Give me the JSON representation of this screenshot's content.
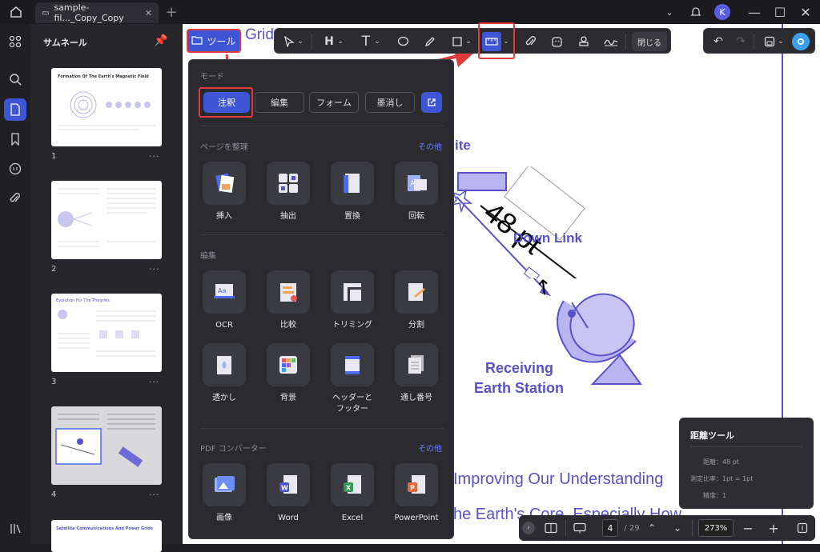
{
  "window": {
    "tab_title": "sample-fil..._Copy_Copy",
    "avatar_initial": "K"
  },
  "sidebar": {
    "title": "サムネール",
    "pages": [
      {
        "num": "1",
        "title": "Formation Of The Earth's Magnetic Field"
      },
      {
        "num": "2"
      },
      {
        "num": "3",
        "title": "Evolution For The Theories"
      },
      {
        "num": "4"
      },
      {
        "title": "Satellite Communications And Power Grids"
      }
    ]
  },
  "document": {
    "top_text": "Grid",
    "label_ite": "ite",
    "measure_label": "48 pt",
    "down_link": "Down Link",
    "receiving_line1": "Receiving",
    "receiving_line2": "Earth Station",
    "body_line1": "Improving Our Understanding",
    "body_line2": "he Earth's Core, Especially How"
  },
  "toolbar": {
    "tool_button": "ツール",
    "close_button": "閉じる"
  },
  "panel": {
    "mode_title": "モード",
    "modes": [
      "注釈",
      "編集",
      "フォーム",
      "墨消し"
    ],
    "organize_title": "ページを整理",
    "organize_more": "その他",
    "organize_tools": [
      "挿入",
      "抽出",
      "置換",
      "回転"
    ],
    "edit_title": "編集",
    "edit_tools_row1": [
      "OCR",
      "比較",
      "トリミング",
      "分割"
    ],
    "edit_tools_row2": [
      "透かし",
      "背景",
      "ヘッダーと\nフッター",
      "通し番号"
    ],
    "converter_title": "PDF コンバーター",
    "converter_more": "その他",
    "converter_tools": [
      "画像",
      "Word",
      "Excel",
      "PowerPoint"
    ]
  },
  "distance_tool": {
    "title": "距離ツール",
    "distance": "距離：48 pt",
    "scale": "測定比率：1pt = 1pt",
    "precision": "精度：1"
  },
  "bottombar": {
    "page_current": "4",
    "page_total": "/ 29",
    "zoom": "273%"
  },
  "colors": {
    "accent": "#3e56d6",
    "doc_purple": "#5752c9",
    "highlight_red": "#e03a3a"
  }
}
